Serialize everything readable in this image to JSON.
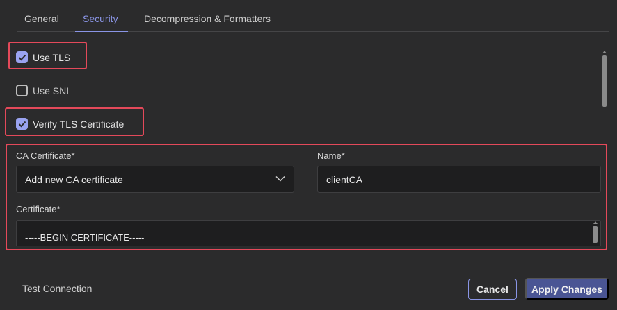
{
  "tabs": [
    {
      "label": "General",
      "active": false
    },
    {
      "label": "Security",
      "active": true
    },
    {
      "label": "Decompression & Formatters",
      "active": false
    }
  ],
  "security": {
    "use_tls": {
      "label": "Use TLS",
      "checked": true
    },
    "use_sni": {
      "label": "Use SNI",
      "checked": false
    },
    "verify_tls": {
      "label": "Verify TLS Certificate",
      "checked": true
    },
    "ca_certificate": {
      "label": "CA Certificate*",
      "value": "Add new CA certificate"
    },
    "name": {
      "label": "Name*",
      "value": "clientCA"
    },
    "certificate": {
      "label": "Certificate*",
      "value": "-----BEGIN CERTIFICATE-----"
    }
  },
  "footer": {
    "test_connection": "Test Connection",
    "cancel": "Cancel",
    "apply": "Apply Changes"
  },
  "colors": {
    "accent": "#8a95e6",
    "highlight": "#e4495a",
    "apply_bg": "#4a5594",
    "background": "#2b2b2c"
  }
}
